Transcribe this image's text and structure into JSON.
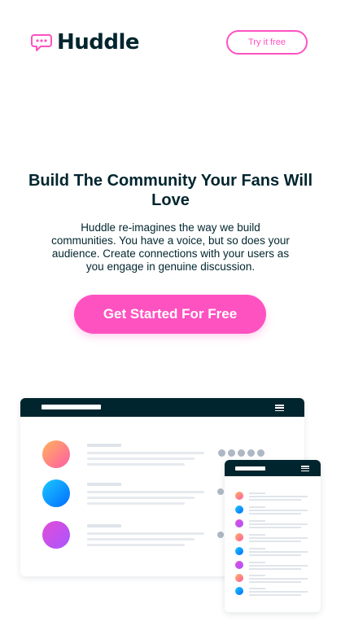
{
  "header": {
    "brand": "Huddle",
    "cta_small": "Try it free"
  },
  "hero": {
    "title": "Build The Community Your Fans Will Love",
    "description": "Huddle re-imagines the way we build communities. You have a voice, but so does your audience. Create connections with your users as you engage in genuine discussion.",
    "cta": "Get Started For Free"
  },
  "colors": {
    "pink": "#ff52c1",
    "dark_navy": "#00252e",
    "white": "#ffffff"
  },
  "illustration": {
    "icons": [
      "chat-bubble-icon",
      "hamburger-menu-icon"
    ]
  }
}
